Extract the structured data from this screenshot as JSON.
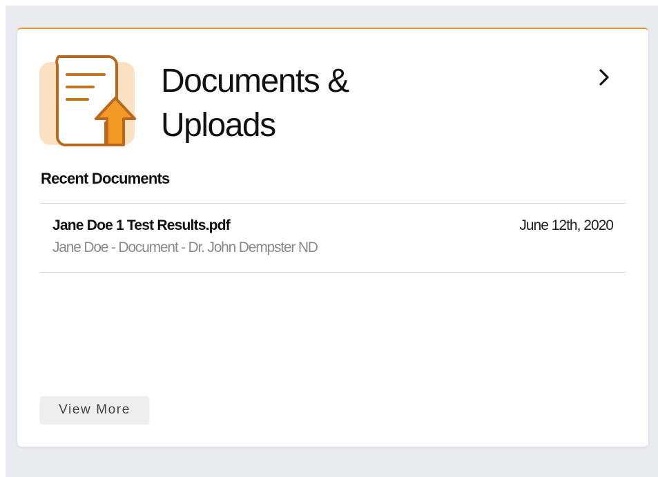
{
  "card": {
    "title": "Documents & Uploads",
    "icon": "document-upload-icon",
    "accent_color": "#e49a33",
    "open_icon": "chevron-right-icon"
  },
  "recent": {
    "heading": "Recent Documents",
    "items": [
      {
        "name": "Jane Doe 1 Test Results.pdf",
        "meta": "Jane Doe - Document - Dr. John Dempster ND",
        "date": "June 12th, 2020"
      }
    ]
  },
  "actions": {
    "view_more_label": "View More"
  }
}
